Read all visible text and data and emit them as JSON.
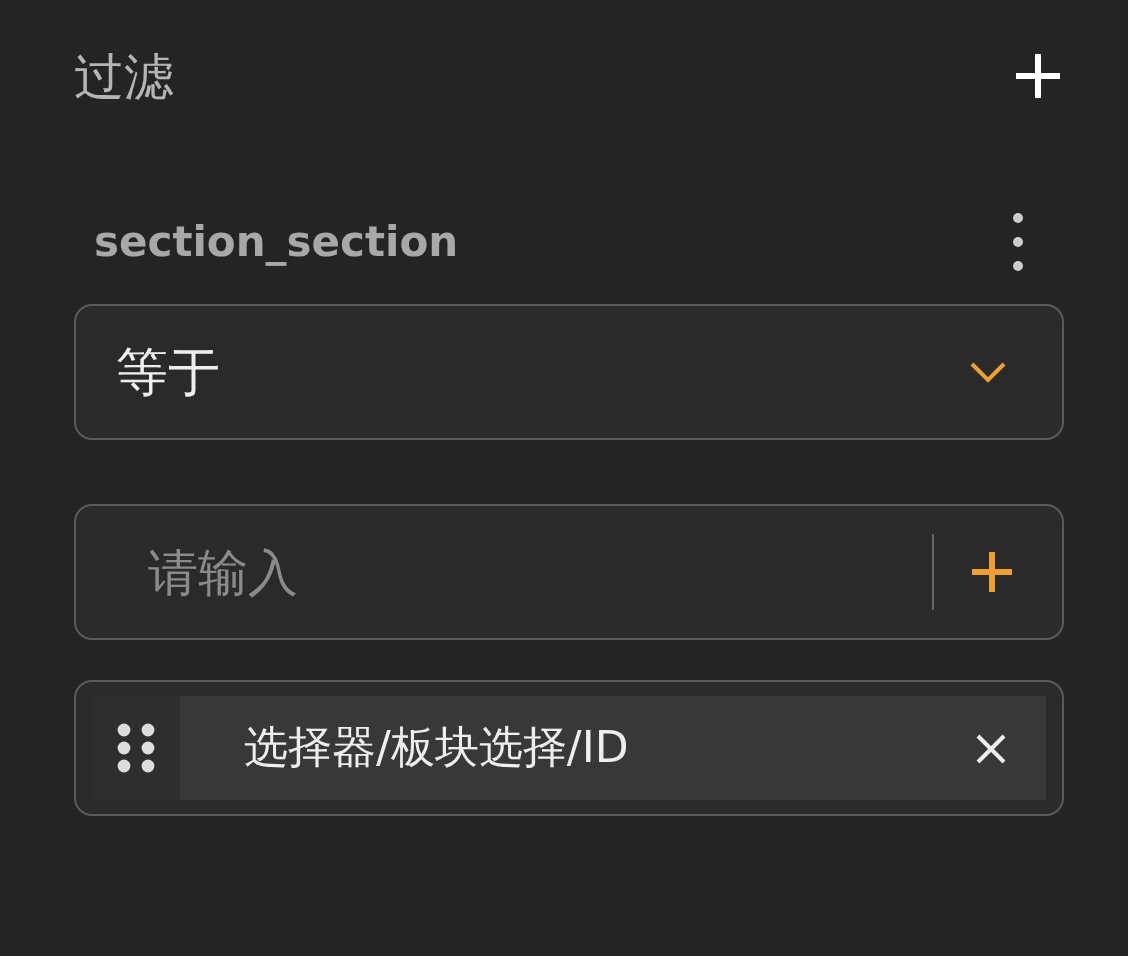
{
  "panel": {
    "title": "过滤"
  },
  "section": {
    "label": "section_section"
  },
  "operator": {
    "value": "等于"
  },
  "input": {
    "placeholder": "请输入"
  },
  "tags": [
    {
      "label": "选择器/板块选择/ID"
    }
  ]
}
